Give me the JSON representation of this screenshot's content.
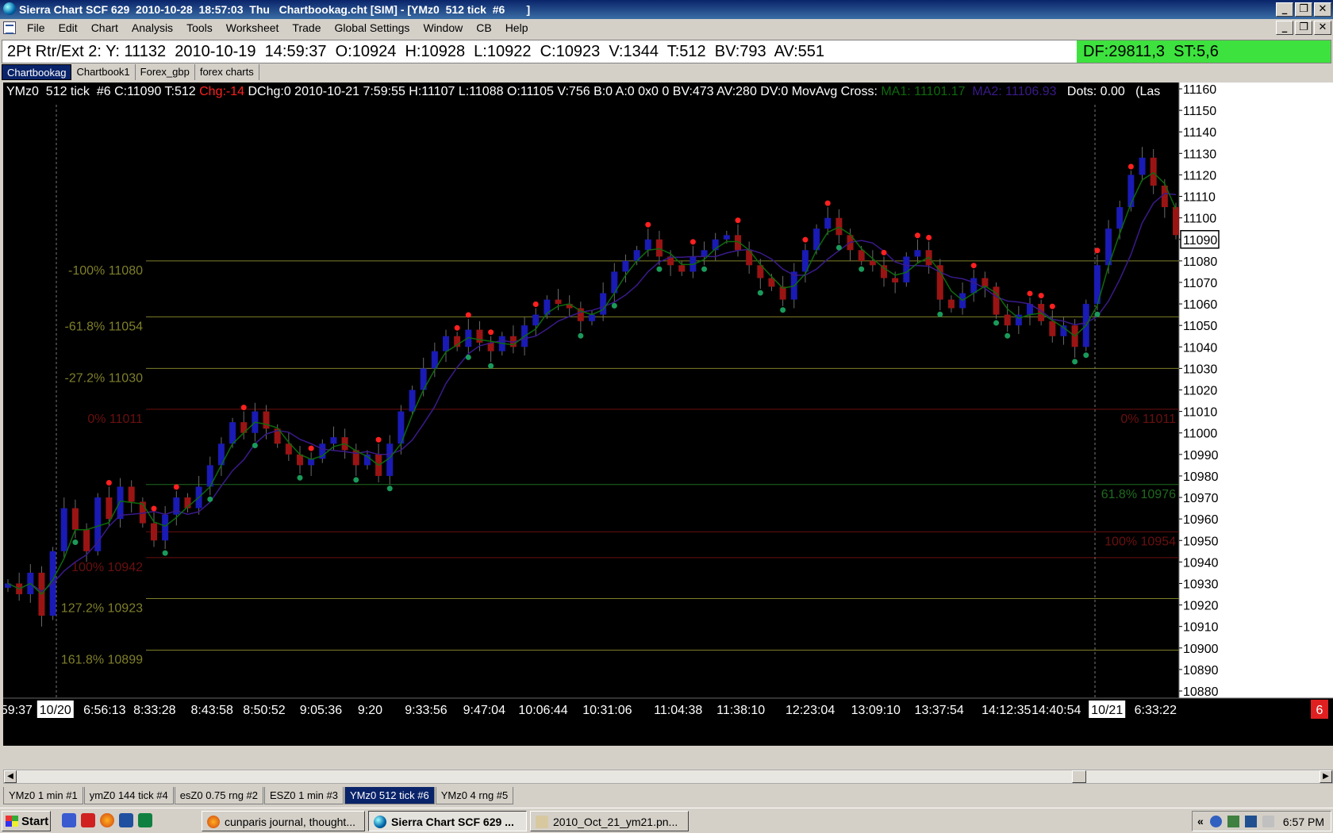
{
  "window": {
    "title": "Sierra Chart SCF 629  2010-10-28  18:57:03  Thu   Chartbookag.cht [SIM] - [YMz0  512 tick  #6       ]",
    "buttons": [
      "_",
      "❐",
      "✕"
    ]
  },
  "menu": {
    "items": [
      "File",
      "Edit",
      "Chart",
      "Analysis",
      "Tools",
      "Worksheet",
      "Trade",
      "Global Settings",
      "Window",
      "CB",
      "Help"
    ],
    "buttons": [
      "_",
      "❐",
      "✕"
    ]
  },
  "infobar": {
    "text": "2Pt Rtr/Ext 2: Y: 11132  2010-10-19  14:59:37  O:10924  H:10928  L:10922  C:10923  V:1344  T:512  BV:793  AV:551",
    "df_text": "DF:29811,3  ST:5,6",
    "df_color": "#3ee23e"
  },
  "chartbook_tabs": [
    "Chartbookag",
    "Chartbook1",
    "Forex_gbp",
    "forex charts"
  ],
  "chart_header": {
    "prefix": "YMz0  512 tick  #6 C:11090 T:512 ",
    "change": "Chg:-14",
    "middle": " DChg:0 2010-10-21 7:59:55 H:11107 L:11088 O:11105 V:756 B:0 A:0 0x0 0 BV:473 AV:280 DV:0 MovAvg Cross: ",
    "ma1": "MA1: 11101.17",
    "ma2": "MA2: 11106.93",
    "dots": "Dots: 0.00",
    "tail": "(Las",
    "change_color": "#ff2020",
    "ma1_color": "#0d6a0d",
    "ma2_color": "#3a1a8a"
  },
  "chart_data": {
    "type": "candlestick",
    "symbol": "YMz0",
    "interval": "512 tick",
    "last_price": "11090",
    "ylim": [
      10880,
      11160
    ],
    "y_ticks": [
      "11160",
      "11150",
      "11140",
      "11130",
      "11120",
      "11110",
      "11100",
      "11090",
      "11080",
      "11070",
      "11060",
      "11050",
      "11040",
      "11030",
      "11020",
      "11010",
      "11000",
      "10990",
      "10980",
      "10970",
      "10960",
      "10950",
      "10940",
      "10930",
      "10920",
      "10910",
      "10900",
      "10890",
      "10880"
    ],
    "x_labels": [
      "59:37",
      "10/20",
      "6:56:13",
      "8:33:28",
      "8:43:58",
      "8:50:52",
      "9:05:36",
      "9:20",
      "9:33:56",
      "9:47:04",
      "10:06:44",
      "10:31:06",
      "11:04:38",
      "11:38:10",
      "12:23:04",
      "13:09:10",
      "13:37:54",
      "14:12:35",
      "14:40:54",
      "10/21",
      "6:33:22"
    ],
    "date_markers": [
      "10/20",
      "10/21"
    ],
    "fib_levels": [
      {
        "label": "-100% 11080",
        "value": 11080,
        "side": "left",
        "color": "#7f7f2a"
      },
      {
        "label": "-61.8% 11054",
        "value": 11054,
        "side": "left",
        "color": "#7f7f2a"
      },
      {
        "label": "-27.2% 11030",
        "value": 11030,
        "side": "left",
        "color": "#7f7f2a"
      },
      {
        "label": "0% 11011",
        "value": 11011,
        "side": "left",
        "color": "#6a1010"
      },
      {
        "label": "100% 10942",
        "value": 10942,
        "side": "left",
        "color": "#6a1010"
      },
      {
        "label": "127.2% 10923",
        "value": 10923,
        "side": "left",
        "color": "#7f7f2a"
      },
      {
        "label": "161.8% 10899",
        "value": 10899,
        "side": "left",
        "color": "#7f7f2a"
      },
      {
        "label": "0% 11011",
        "value": 11011,
        "side": "right",
        "color": "#6a1010"
      },
      {
        "label": "61.8% 10976",
        "value": 10976,
        "side": "right",
        "color": "#1f6a1f"
      },
      {
        "label": "100% 10954",
        "value": 10954,
        "side": "right",
        "color": "#6a1010"
      }
    ],
    "price_path": [
      10930,
      10925,
      10935,
      10915,
      10945,
      10965,
      10955,
      10945,
      10970,
      10960,
      10975,
      10968,
      10958,
      10950,
      10962,
      10970,
      10965,
      10975,
      10985,
      10995,
      11005,
      11000,
      11010,
      11002,
      10995,
      10990,
      10985,
      10988,
      10995,
      10998,
      10992,
      10985,
      10990,
      10980,
      10995,
      11010,
      11020,
      11030,
      11038,
      11045,
      11040,
      11048,
      11042,
      11038,
      11045,
      11040,
      11050,
      11055,
      11062,
      11060,
      11058,
      11052,
      11055,
      11065,
      11075,
      11080,
      11085,
      11090,
      11082,
      11078,
      11075,
      11082,
      11085,
      11090,
      11092,
      11085,
      11078,
      11072,
      11068,
      11062,
      11075,
      11085,
      11095,
      11100,
      11092,
      11085,
      11080,
      11078,
      11072,
      11070,
      11082,
      11085,
      11078,
      11062,
      11058,
      11065,
      11072,
      11068,
      11055,
      11050,
      11055,
      11060,
      11052,
      11045,
      11050,
      11040,
      11060,
      11078,
      11095,
      11105,
      11120,
      11128,
      11115,
      11105,
      11092
    ],
    "series": [
      {
        "name": "MA1: 11101.17",
        "color": "#0d6a0d"
      },
      {
        "name": "MA2: 11106.93",
        "color": "#3a1a8a"
      }
    ],
    "colors": {
      "up": "#1a1ab4",
      "down": "#9a1414",
      "wick": "#6a6a6a",
      "high_dot": "#ff2020",
      "low_dot": "#1a9a5a"
    },
    "high_dot_bars": [
      9,
      13,
      15,
      21,
      27,
      33,
      40,
      41,
      43,
      47,
      57,
      61,
      65,
      71,
      73,
      78,
      81,
      82,
      86,
      91,
      92,
      93,
      97,
      100
    ],
    "low_dot_bars": [
      6,
      14,
      18,
      22,
      26,
      31,
      34,
      41,
      43,
      51,
      54,
      58,
      62,
      67,
      69,
      74,
      76,
      83,
      88,
      89,
      95,
      96,
      97
    ],
    "axis_count_badge": "6"
  },
  "scrollbar": {
    "left": "◀",
    "right": "▶"
  },
  "chart_tabs": [
    "YMz0  1 min   #1",
    "ymZ0  144 tick  #4",
    "esZ0  0.75 rng  #2",
    "ESZ0  1 min   #3",
    "YMz0  512 tick  #6",
    "YMz0  4 rng   #5"
  ],
  "taskbar": {
    "start": "Start",
    "tasks": [
      "cunparis journal, thought...",
      "Sierra Chart SCF 629  ...",
      "2010_Oct_21_ym21.pn..."
    ],
    "clock": "6:57 PM",
    "chevron": "«"
  }
}
